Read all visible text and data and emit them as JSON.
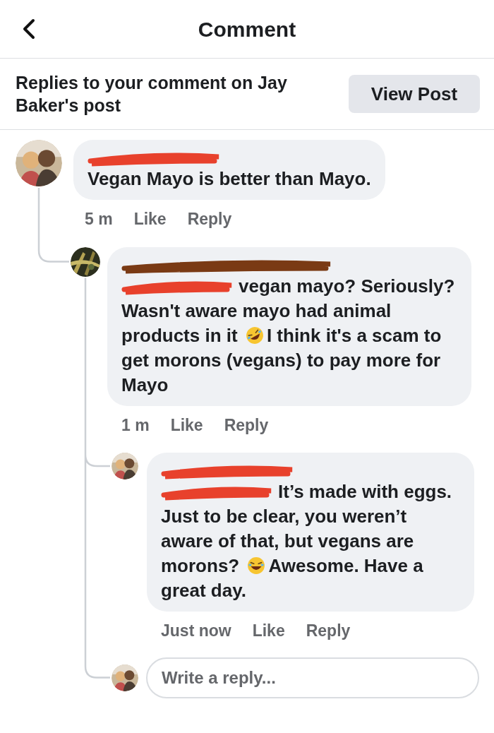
{
  "header": {
    "title": "Comment"
  },
  "notice": {
    "text": "Replies to your comment on Jay Baker's post",
    "button": "View Post"
  },
  "comments": [
    {
      "avatar": {
        "kind": "picture"
      },
      "author": {
        "kind": "redaction",
        "color": "#e8412c"
      },
      "segments": [
        {
          "kind": "text",
          "text": "Vegan Mayo is better than Mayo."
        }
      ],
      "time": "5 m",
      "actions": [
        "Like",
        "Reply"
      ],
      "children": [
        {
          "avatar": {
            "kind": "picture"
          },
          "author": {
            "kind": "redaction",
            "color": "#7a3a14"
          },
          "segments": [
            {
              "kind": "redaction",
              "color": "#e8412c"
            },
            {
              "kind": "text",
              "text": "vegan mayo? Seriously? Wasn't aware mayo had animal products in it"
            },
            {
              "kind": "emoji",
              "tilted": true
            },
            {
              "kind": "text",
              "text": "I think it's a scam to get morons (vegans) to pay more for Mayo"
            }
          ],
          "time": "1 m",
          "actions": [
            "Like",
            "Reply"
          ],
          "children": [
            {
              "avatar": {
                "kind": "picture"
              },
              "author": {
                "kind": "redaction",
                "color": "#e8412c"
              },
              "segments": [
                {
                  "kind": "redaction",
                  "color": "#e8412c"
                },
                {
                  "kind": "text",
                  "text": "It’s made with eggs. Just to be clear, you weren’t aware of that, but vegans are morons?"
                },
                {
                  "kind": "emoji",
                  "tilted": false
                },
                {
                  "kind": "text",
                  "text": "Awesome. Have a great day."
                }
              ],
              "time": "Just now",
              "actions": [
                "Like",
                "Reply"
              ]
            }
          ]
        }
      ]
    }
  ],
  "reply_field": {
    "placeholder": "Write a reply..."
  }
}
